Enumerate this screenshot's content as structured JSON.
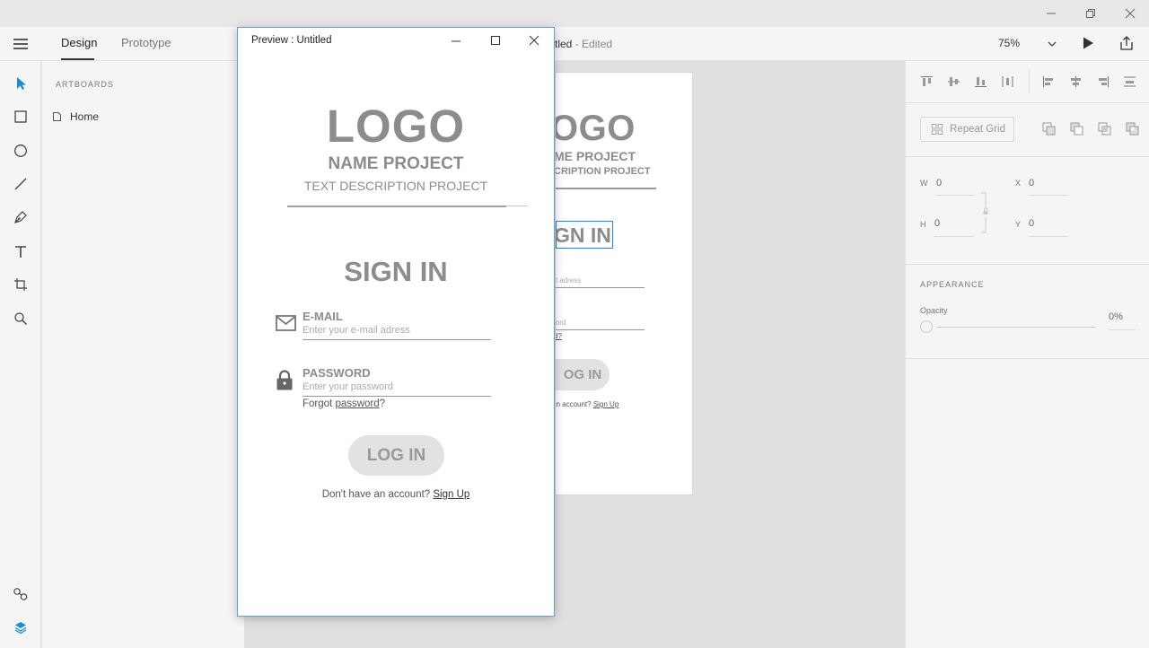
{
  "app": {
    "doc_title": "tled",
    "doc_status": " - Edited",
    "tabs": [
      "Design",
      "Prototype"
    ],
    "zoom": "75%"
  },
  "layers_panel": {
    "heading": "ARTBOARDS",
    "items": [
      {
        "label": "Home"
      }
    ]
  },
  "tools": [
    "select-tool",
    "rectangle-tool",
    "ellipse-tool",
    "line-tool",
    "pen-tool",
    "text-tool",
    "artboard-tool",
    "zoom-tool"
  ],
  "right_panel": {
    "repeat_grid_label": "Repeat Grid",
    "w_label": "W",
    "w_value": "0",
    "h_label": "H",
    "h_value": "0",
    "x_label": "X",
    "x_value": "0",
    "y_label": "Y",
    "y_value": "0",
    "appearance_heading": "APPEARANCE",
    "opacity_label": "Opacity",
    "opacity_value": "0%"
  },
  "preview": {
    "window_title": "Preview : Untitled",
    "logo": "LOGO",
    "name_project": "NAME PROJECT",
    "text_description": "TEXT DESCRIPTION PROJECT",
    "sign_in": "SIGN IN",
    "email_label": "E-MAIL",
    "email_placeholder": "Enter your e-mail adress",
    "password_label": "PASSWORD",
    "password_placeholder": "Enter your password",
    "forgot_prefix": "Forgot ",
    "forgot_link": "password",
    "forgot_suffix": "?",
    "login_button": "LOG IN",
    "no_account": "Don't have an account? ",
    "sign_up": "Sign Up"
  },
  "artboard": {
    "logo_partial": "OGO",
    "name_partial": "ME PROJECT",
    "desc_partial": "CRIPTION PROJECT",
    "sign_in_partial": "GN IN",
    "email_partial": "ail adress",
    "password_partial": "word",
    "forgot_partial": "d?",
    "login_partial": "OG IN",
    "account_partial": "an account? ",
    "sign_up": "Sign Up"
  },
  "colors": {
    "accent": "#1a8bd8",
    "text_gray": "#8c8c8c",
    "button_bg": "#e2e2e2"
  }
}
